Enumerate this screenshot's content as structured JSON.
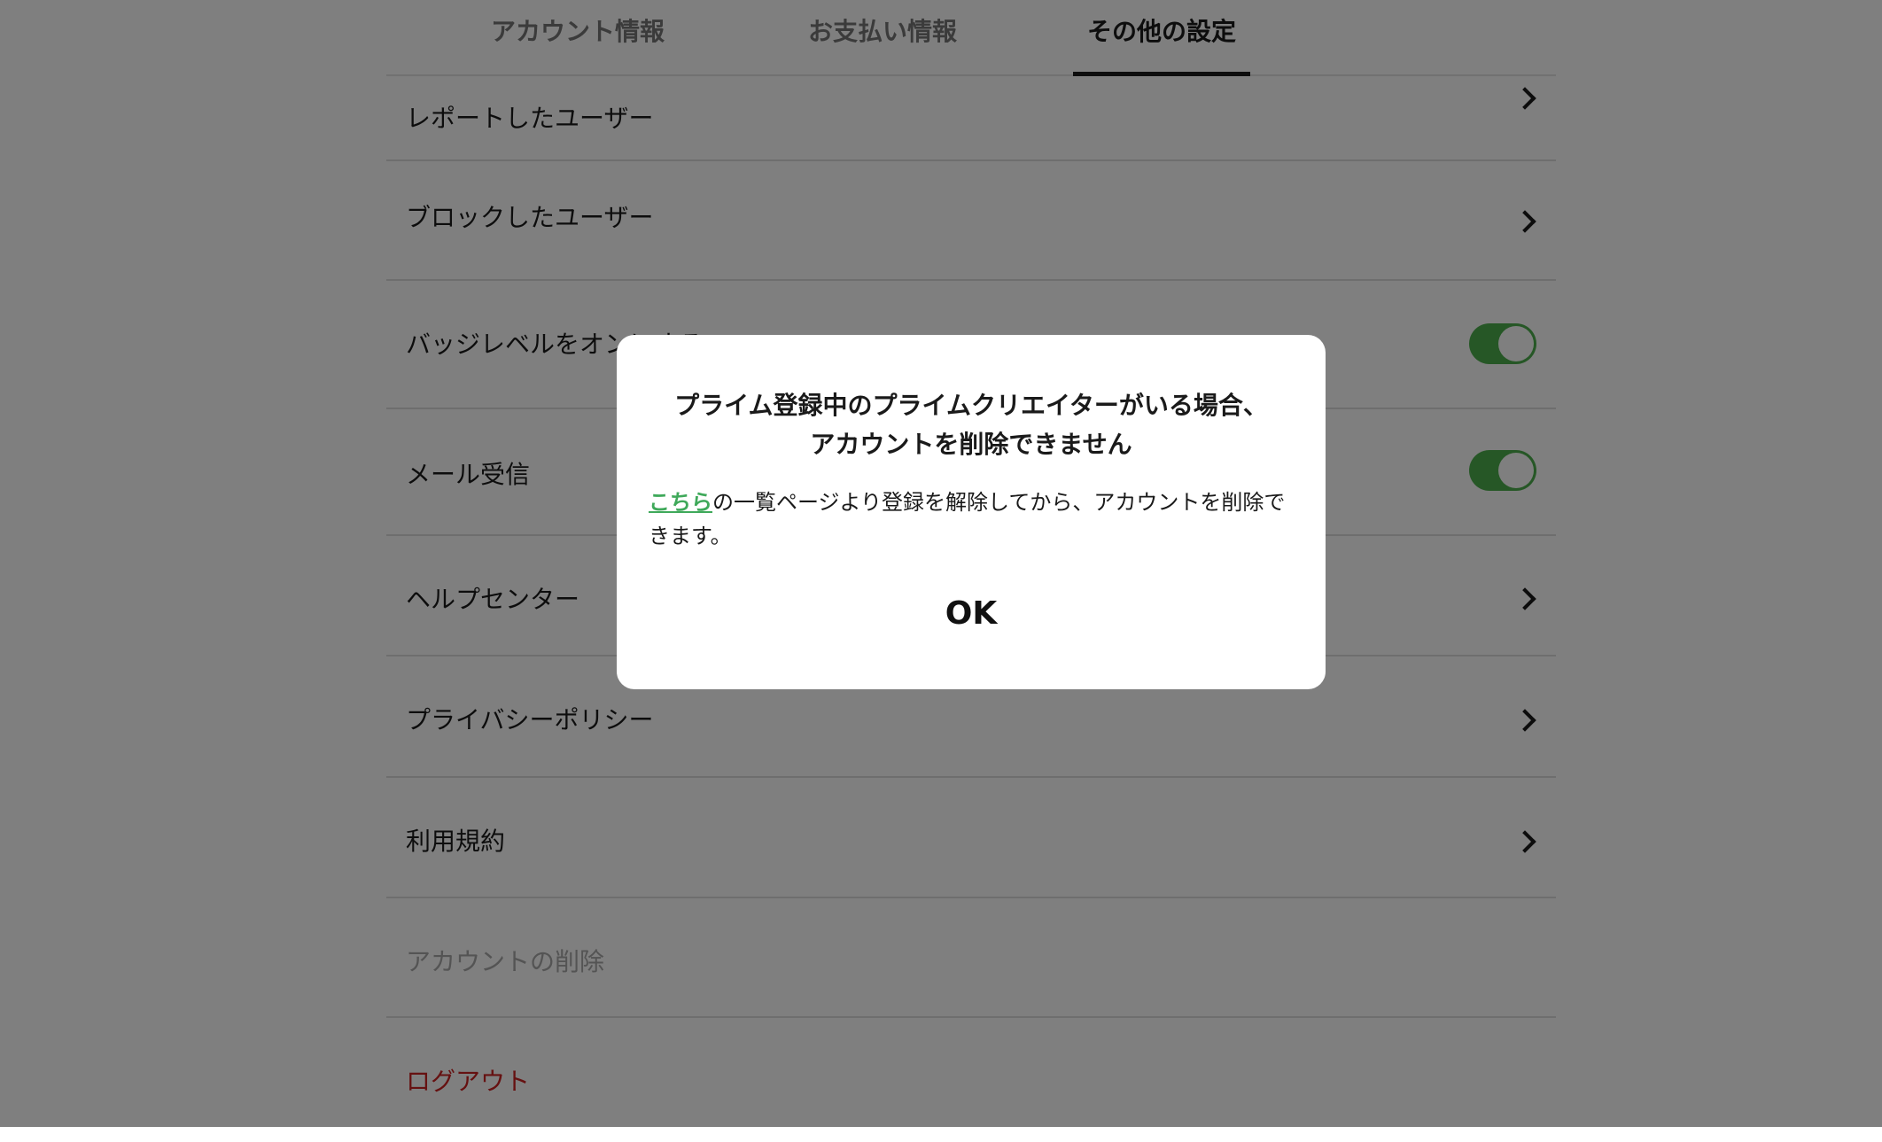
{
  "tabs": [
    {
      "label": "アカウント情報",
      "active": false
    },
    {
      "label": "お支払い情報",
      "active": false
    },
    {
      "label": "その他の設定",
      "active": true
    }
  ],
  "settings": {
    "reported_users": "レポートしたユーザー",
    "blocked_users": "ブロックしたユーザー",
    "badge_level": {
      "label": "バッジレベルをオンにする",
      "enabled": true
    },
    "mail_receive": {
      "label": "メール受信",
      "enabled": true
    },
    "help_center": "ヘルプセンター",
    "privacy_policy": "プライバシーポリシー",
    "terms": "利用規約",
    "delete_account": "アカウントの削除",
    "logout": "ログアウト"
  },
  "dialog": {
    "title_line1": "プライム登録中のプライムクリエイターがいる場合、",
    "title_line2": "アカウントを削除できません",
    "link_text": "こちら",
    "body_text": "の一覧ページより登録を解除してから、アカウントを削除できます。",
    "ok_label": "OK"
  },
  "colors": {
    "toggle_on": "#4cae4c",
    "link": "#3fa95a",
    "danger": "#cc2222",
    "disabled": "#a8a8a8",
    "overlay": "rgba(0,0,0,0.5)"
  }
}
